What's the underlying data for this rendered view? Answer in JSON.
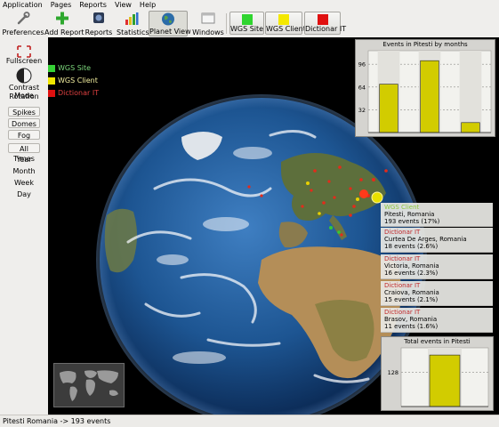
{
  "menu": [
    "Application",
    "Pages",
    "Reports",
    "View",
    "Help"
  ],
  "toolbar": {
    "preferences": "Preferences",
    "add_report": "Add Report",
    "reports": "Reports",
    "statistics": "Statistics",
    "planet_view": "Planet View",
    "windows": "Windows"
  },
  "legend_buttons": [
    {
      "label": "WGS Site",
      "color": "#2fd52f"
    },
    {
      "label": "WGS Client",
      "color": "#f4e800"
    },
    {
      "label": "Dictionar IT",
      "color": "#e01010"
    }
  ],
  "left_panel": {
    "fullscreen": "Fullscreen",
    "contrast_mode": "Contrast Mode",
    "rotation": "Rotation",
    "spikes": "Spikes",
    "domes": "Domes",
    "fog": "Fog",
    "all_times": "All Times",
    "year": "Year",
    "month": "Month",
    "week": "Week",
    "day": "Day"
  },
  "view_legend": [
    {
      "label": "WGS Site",
      "color": "#35d035"
    },
    {
      "label": "WGS Client",
      "color": "#f0e600"
    },
    {
      "label": "Dictionar IT",
      "color": "#e01010"
    }
  ],
  "chart_data": [
    {
      "type": "bar",
      "title": "Events in Pitesti by months",
      "yticks": [
        32,
        64,
        96
      ],
      "ylim": [
        0,
        115
      ],
      "values": [
        68,
        101,
        14
      ],
      "grid": true,
      "color": "#d2cc00"
    },
    {
      "type": "bar",
      "title": "Total events in Pitesti",
      "yticks": [
        128
      ],
      "ylim": [
        0,
        220
      ],
      "values": [
        193
      ],
      "grid": true,
      "color": "#d2cc00"
    }
  ],
  "info": [
    {
      "name": "WGS Client",
      "color": "#8cc73a",
      "place": "Pitesti, Romania",
      "events": "193 events (17%)"
    },
    {
      "name": "Dictionar IT",
      "color": "#c0282a",
      "place": "Curtea De Arges, Romania",
      "events": "18 events (2.6%)"
    },
    {
      "name": "Dictionar IT",
      "color": "#c0282a",
      "place": "Victoria, Romania",
      "events": "16 events (2.3%)"
    },
    {
      "name": "Dictionar IT",
      "color": "#c0282a",
      "place": "Craiova, Romania",
      "events": "15 events (2.1%)"
    },
    {
      "name": "Dictionar IT",
      "color": "#c0282a",
      "place": "Brasov, Romania",
      "events": "11 events (1.6%)"
    }
  ],
  "status": "Pitesti  Romania -> 193 events"
}
